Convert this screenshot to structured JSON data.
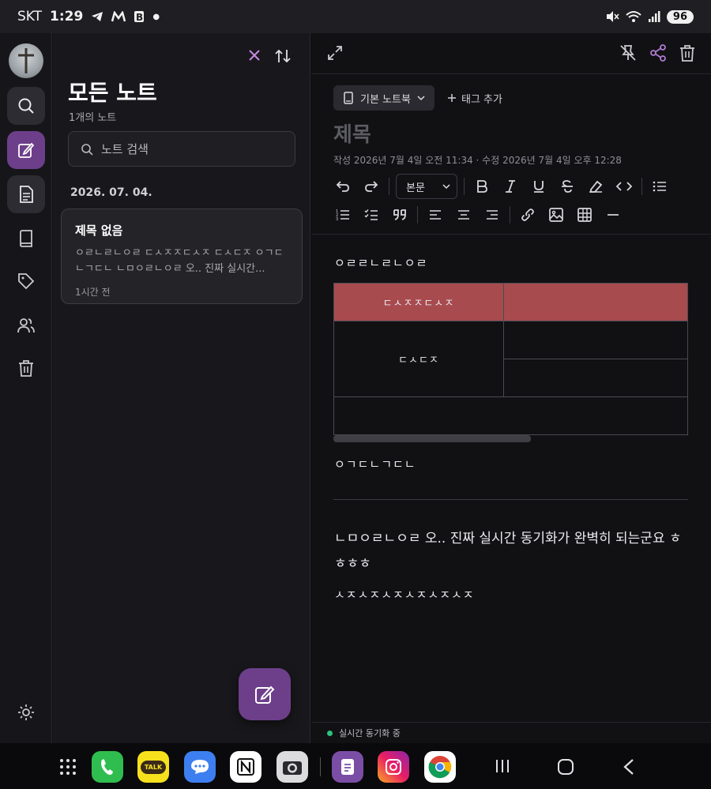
{
  "status_bar": {
    "carrier": "SKT",
    "time": "1:29",
    "battery": "96"
  },
  "list_panel": {
    "title": "모든 노트",
    "count": "1개의 노트",
    "search_placeholder": "노트 검색",
    "date_header": "2026. 07. 04.",
    "notes": [
      {
        "title": "제목 없음",
        "preview": "ㅇㄹㄴㄹㄴㅇㄹ ㄷㅅㅈㅈㄷㅅㅈ ㄷㅅㄷㅈ ㅇㄱㄷㄴㄱㄷㄴ ㄴㅁㅇㄹㄴㅇㄹ 오.. 진짜 실시간...",
        "time": "1시간 전"
      }
    ]
  },
  "editor": {
    "notebook": "기본 노트북",
    "add_tag": "태그 추가",
    "title_placeholder": "제목",
    "meta": "작성 2026년 7월 4일 오전 11:34 · 수정 2026년 7월 4일 오후 12:28",
    "block_type": "본문",
    "content": {
      "para1": "ㅇㄹㄹㄴㄹㄴㅇㄹ",
      "table": {
        "header_left": "ㄷㅅㅈㅈㄷㅅㅈ",
        "header_right": "",
        "merged_cell": "ㄷㅅㄷㅈ"
      },
      "para2": "ㅇㄱㄷㄴㄱㄷㄴ",
      "para3": "ㄴㅁㅇㄹㄴㅇㄹ 오.. 진짜 실시간 동기화가 완벽히 되는군요 ㅎㅎㅎㅎ",
      "para4": "ㅅㅈㅅㅈㅅㅈㅅㅈㅅㅈㅅㅈ"
    },
    "sync_status": "실시간 동기화 중"
  },
  "dock": {
    "apps": [
      "app-drawer",
      "phone",
      "kakaotalk",
      "messages",
      "notion",
      "camera",
      "notes",
      "instagram",
      "chrome"
    ],
    "kakaotalk_label": "TALK"
  },
  "colors": {
    "accent": "#6d3f8a",
    "table_header": "#a84b4f",
    "sync": "#2ec27e"
  }
}
